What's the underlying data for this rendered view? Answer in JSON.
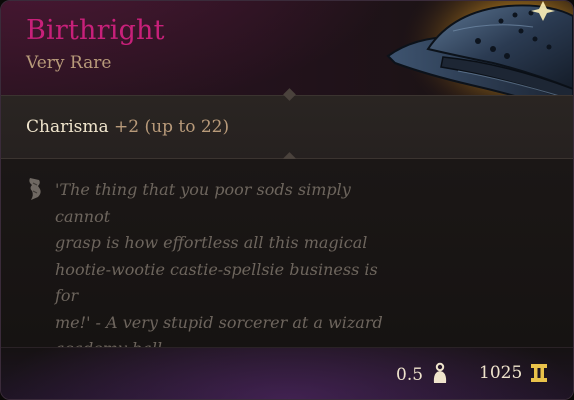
{
  "item": {
    "name": "Birthright",
    "rarity": "Very Rare",
    "rarity_color": "#c8207a"
  },
  "property": {
    "name": "Charisma",
    "value": "+2 (up to 22)"
  },
  "flavor": {
    "icon": "quill-icon",
    "lines": [
      "'The thing that you poor sods simply cannot",
      "grasp is how effortless all this magical",
      "hootie-wootie castie-spellsie business is for",
      "me!' - A very stupid sorcerer at a wizard",
      "academy ball."
    ]
  },
  "footer": {
    "weight": "0.5",
    "weight_icon": "weight-icon",
    "price": "1025",
    "price_icon": "gold-coin-icon"
  },
  "art": {
    "icon": "wizard-hat-icon"
  }
}
